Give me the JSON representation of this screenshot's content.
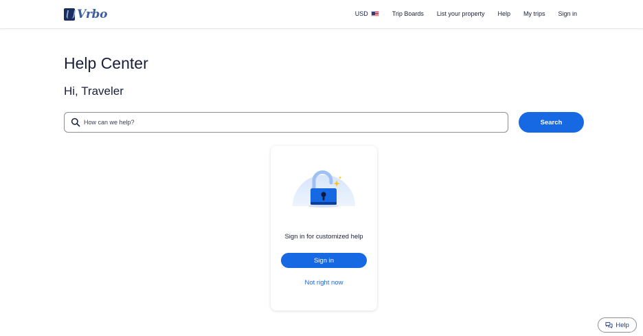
{
  "header": {
    "logo_text": "Vrbo",
    "nav": {
      "currency": "USD",
      "trip_boards": "Trip Boards",
      "list_property": "List your property",
      "help": "Help",
      "my_trips": "My trips",
      "sign_in": "Sign in"
    }
  },
  "main": {
    "title": "Help Center",
    "greeting": "Hi, Traveler",
    "search": {
      "placeholder": "How can we help?",
      "value": "",
      "button_label": "Search"
    }
  },
  "signin_card": {
    "message": "Sign in for customized help",
    "signin_label": "Sign in",
    "dismiss_label": "Not right now"
  },
  "help_widget": {
    "label": "Help"
  },
  "colors": {
    "primary": "#1668e3",
    "text": "#191e3b",
    "logo": "#3e5f9c",
    "help_text": "#1f3e8a"
  },
  "icons": [
    "vrbo-logo-icon",
    "us-flag-icon",
    "search-icon",
    "lock-icon",
    "sparkle-icon",
    "chat-bubbles-icon"
  ]
}
